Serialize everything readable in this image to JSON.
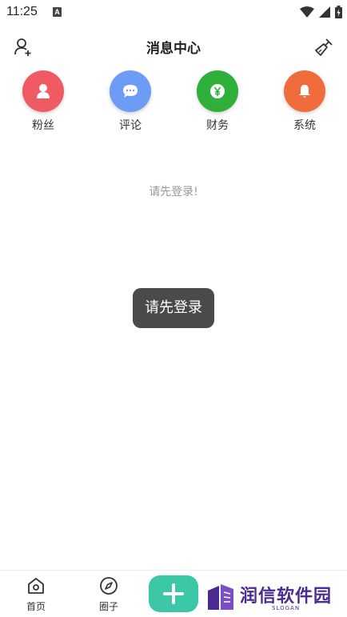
{
  "status_bar": {
    "time": "11:25",
    "notification_badge": "A"
  },
  "header": {
    "title": "消息中心",
    "left_icon": "user-add-icon",
    "right_icon": "broom-clear-icon"
  },
  "categories": [
    {
      "label": "粉丝",
      "icon": "person-icon",
      "color": "#ef5a63"
    },
    {
      "label": "评论",
      "icon": "chat-bubble-icon",
      "color": "#6d9cf6"
    },
    {
      "label": "财务",
      "icon": "yen-coin-icon",
      "color": "#2fb03a"
    },
    {
      "label": "系统",
      "icon": "bell-icon",
      "color": "#f06c3c"
    }
  ],
  "empty_message": "请先登录!",
  "toast": "请先登录",
  "tabbar": {
    "home_label": "首页",
    "circle_label": "圈子",
    "add_color": "#3cc7a6"
  },
  "watermark": {
    "text": "润信软件园",
    "slogan": "SLOGAN"
  }
}
